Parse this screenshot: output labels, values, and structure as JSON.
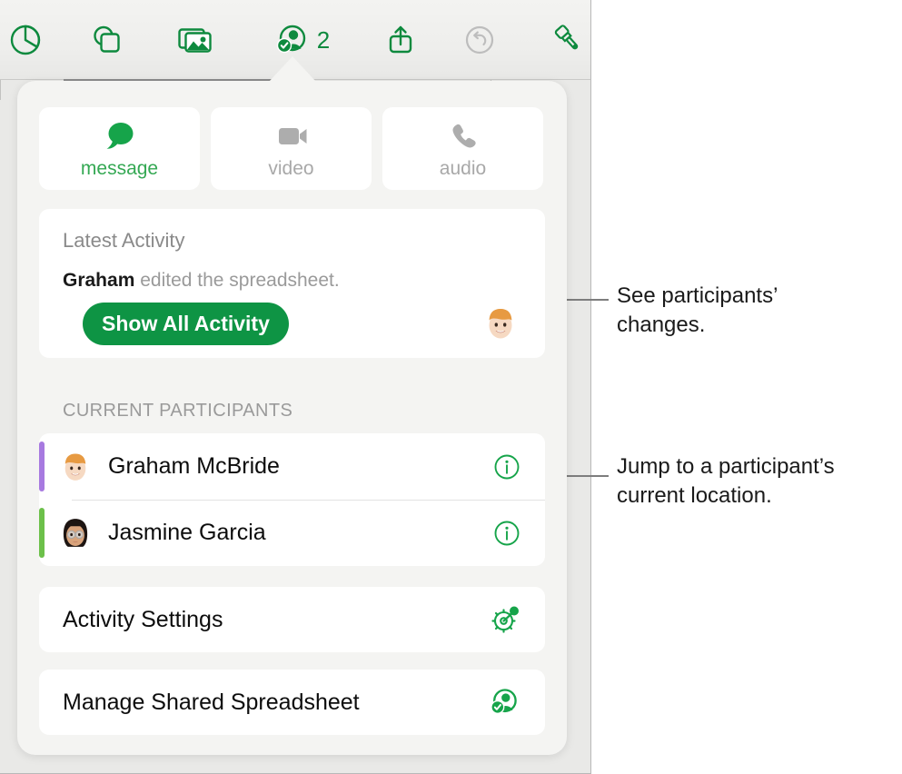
{
  "toolbar": {
    "items": [
      {
        "name": "chart-icon",
        "label": "Chart",
        "state": "enabled"
      },
      {
        "name": "shape-icon",
        "label": "Shape",
        "state": "enabled"
      },
      {
        "name": "media-icon",
        "label": "Media",
        "state": "enabled"
      },
      {
        "name": "collaborate-icon",
        "label": "Collaborate",
        "state": "active"
      },
      {
        "name": "share-icon",
        "label": "Share",
        "state": "enabled"
      },
      {
        "name": "undo-icon",
        "label": "Undo",
        "state": "disabled"
      },
      {
        "name": "format-icon",
        "label": "Format",
        "state": "enabled"
      }
    ],
    "participant_count": "2"
  },
  "contact": {
    "buttons": [
      {
        "label": "message",
        "icon": "message-bubble-icon",
        "state": "enabled"
      },
      {
        "label": "video",
        "icon": "video-camera-icon",
        "state": "disabled"
      },
      {
        "label": "audio",
        "icon": "phone-icon",
        "state": "disabled"
      }
    ]
  },
  "activity": {
    "title": "Latest Activity",
    "entry_name": "Graham",
    "entry_text": " edited the spreadsheet.",
    "show_all_label": "Show All Activity",
    "avatar": "memoji-graham-avatar"
  },
  "participants": {
    "header": "CURRENT PARTICIPANTS",
    "rows": [
      {
        "name": "Graham McBride",
        "color": "#a77ae0",
        "avatar": "memoji-graham-avatar",
        "info_icon": "info-circle-icon"
      },
      {
        "name": "Jasmine Garcia",
        "color": "#6cc04a",
        "avatar": "memoji-jasmine-avatar",
        "info_icon": "info-circle-icon"
      }
    ]
  },
  "actions": [
    {
      "label": "Activity Settings",
      "icon": "gear-activity-icon"
    },
    {
      "label": "Manage Shared Spreadsheet",
      "icon": "person-check-icon"
    }
  ],
  "callouts": [
    {
      "line1": "See participants’",
      "line2": "changes."
    },
    {
      "line1": "Jump to a participant’s",
      "line2": "current location."
    }
  ],
  "colors": {
    "accent_green": "#0e9444",
    "message_green": "#34a853",
    "disabled_gray": "#a8a8a8",
    "participant_purple": "#a77ae0",
    "participant_green": "#6cc04a"
  }
}
